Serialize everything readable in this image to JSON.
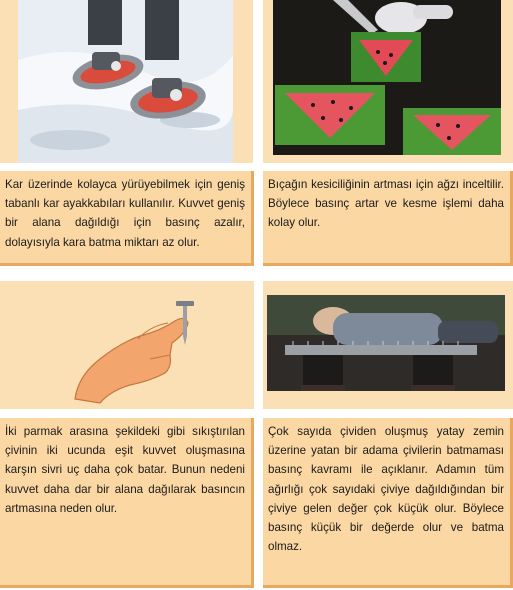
{
  "cards": [
    {
      "image": "snowshoe-photo",
      "caption": "Kar üzerinde kolayca yürüyebilmek için geniş tabanlı kar ayakkabıları kullanılır. Kuvvet geniş bir alana dağıldığı için basınç azalır, dolayısıyla kara batma miktarı az olur."
    },
    {
      "image": "watermelon-cake-photo",
      "caption": "Bıçağın kesiciliğinin artması için ağzı inceltilir. Böylece basınç artar ve kesme işlemi daha kolay olur."
    },
    {
      "image": "hand-nail-drawing",
      "caption": "İki parmak arasına şekildeki gibi sıkıştırılan çivinin iki ucunda eşit kuvvet oluşmasına karşın sivri uç daha çok batar. Bunun nedeni kuvvet daha dar bir alana dağılarak basıncın artmasına neden olur."
    },
    {
      "image": "bed-of-nails-photo",
      "caption": "Çok sayıda çividen oluşmuş yatay zemin üzerine yatan bir adama çivilerin batmaması basınç kavramı ile açıklanır. Adamın tüm ağırlığı çok sayıdaki çiviye dağıldığından bir çiviye gelen değer çok küçük olur. Böylece basınç küçük bir değerde olur ve batma olmaz."
    }
  ]
}
